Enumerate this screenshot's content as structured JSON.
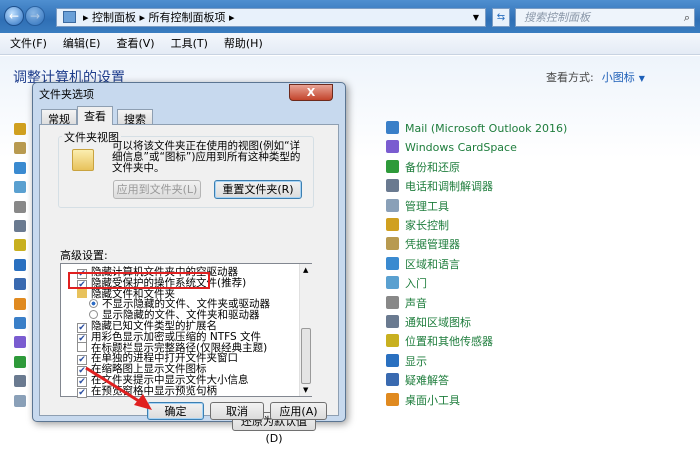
{
  "explorer": {
    "breadcrumb": [
      "控制面板",
      "所有控制面板项"
    ],
    "search_placeholder": "搜索控制面板",
    "menu": [
      "文件(F)",
      "编辑(E)",
      "查看(V)",
      "工具(T)",
      "帮助(H)"
    ],
    "page_title": "调整计算机的设置",
    "view_by_label": "查看方式:",
    "view_by_value": "小图标",
    "items_right": [
      "Mail (Microsoft Outlook 2016)",
      "Windows CardSpace",
      "备份和还原",
      "电话和调制解调器",
      "管理工具",
      "家长控制",
      "凭据管理器",
      "区域和语言",
      "入门",
      "声音",
      "通知区域图标",
      "位置和其他传感器",
      "显示",
      "疑难解答",
      "桌面小工具"
    ],
    "link_color": "#1e7d3c"
  },
  "dialog": {
    "title": "文件夹选项",
    "close": "X",
    "tabs": [
      "常规",
      "查看",
      "搜索"
    ],
    "active_tab": "查看",
    "folder_view": {
      "legend": "文件夹视图",
      "description": "可以将该文件夹正在使用的视图(例如“详细信息”或“图标”)应用到所有这种类型的文件夹中。",
      "apply_btn": "应用到文件夹(L)",
      "reset_btn": "重置文件夹(R)"
    },
    "advanced_label": "高级设置:",
    "advanced_items": [
      {
        "type": "checkbox",
        "label": "隐藏计算机文件夹中的空驱动器",
        "checked": true
      },
      {
        "type": "checkbox",
        "label": "隐藏受保护的操作系统文件(推荐)",
        "checked": true
      },
      {
        "type": "folder",
        "label": "隐藏文件和文件夹"
      },
      {
        "type": "radio",
        "label": "不显示隐藏的文件、文件夹或驱动器",
        "checked": true
      },
      {
        "type": "radio",
        "label": "显示隐藏的文件、文件夹和驱动器",
        "checked": false
      },
      {
        "type": "checkbox",
        "label": "隐藏已知文件类型的扩展名",
        "checked": true,
        "highlighted": true
      },
      {
        "type": "checkbox",
        "label": "用彩色显示加密或压缩的 NTFS 文件",
        "checked": true
      },
      {
        "type": "checkbox",
        "label": "在标题栏显示完整路径(仅限经典主题)",
        "checked": false
      },
      {
        "type": "checkbox",
        "label": "在单独的进程中打开文件夹窗口",
        "checked": true
      },
      {
        "type": "checkbox",
        "label": "在缩略图上显示文件图标",
        "checked": true
      },
      {
        "type": "checkbox",
        "label": "在文件夹提示中显示文件大小信息",
        "checked": true
      },
      {
        "type": "checkbox",
        "label": "在预览窗格中显示预览句柄",
        "checked": true
      }
    ],
    "restore_btn": "还原为默认值(D)",
    "ok": "确定",
    "cancel": "取消",
    "apply": "应用(A)"
  },
  "annotation_color": "#e02020"
}
